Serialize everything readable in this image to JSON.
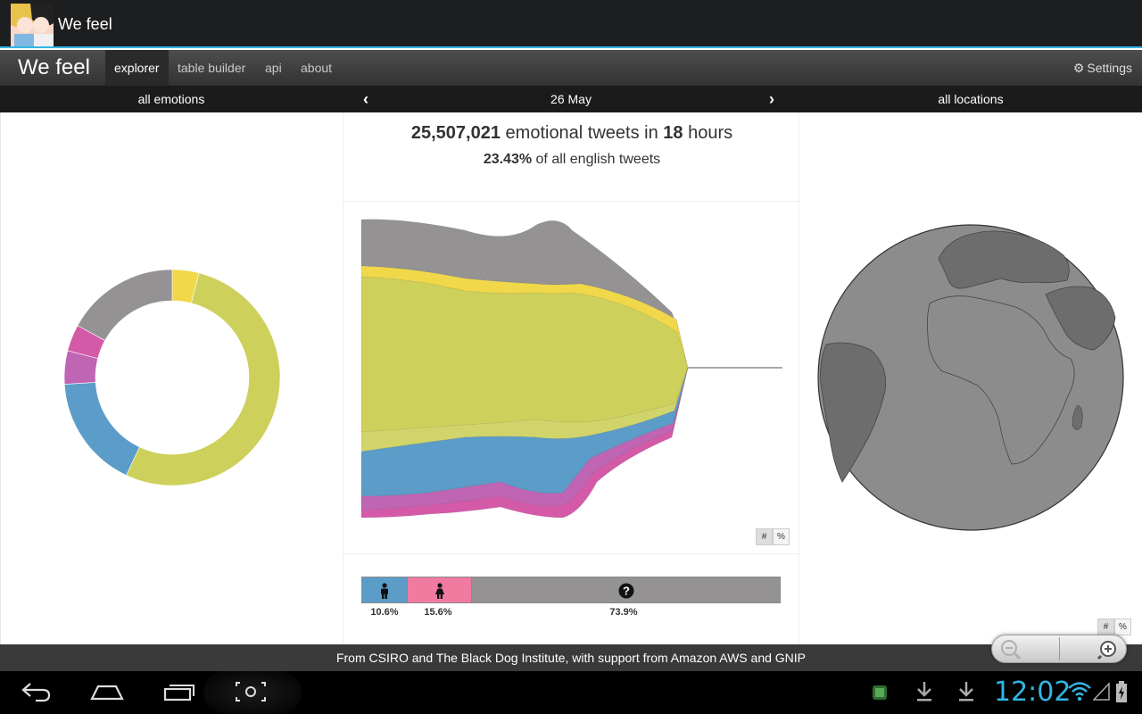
{
  "app": {
    "title": "We feel"
  },
  "navbar": {
    "brand": "We feel",
    "items": [
      {
        "label": "explorer",
        "active": true
      },
      {
        "label": "table builder",
        "active": false
      },
      {
        "label": "api",
        "active": false
      },
      {
        "label": "about",
        "active": false
      }
    ],
    "settings_label": "Settings"
  },
  "filterbar": {
    "emotions": "all emotions",
    "date": "26 May",
    "locations": "all locations"
  },
  "stats": {
    "tweet_count": "25,507,021",
    "tweets_text": "emotional tweets in",
    "hours": "18",
    "hours_text": "hours",
    "percent": "23.43%",
    "percent_text": "of all english tweets"
  },
  "toggles": {
    "count_label": "#",
    "percent_label": "%"
  },
  "gender": {
    "segments": [
      {
        "name": "male",
        "percent": 10.6,
        "label": "10.6%",
        "color": "#5b9cc8"
      },
      {
        "name": "female",
        "percent": 15.6,
        "label": "15.6%",
        "color": "#f07aa0"
      },
      {
        "name": "unknown",
        "percent": 73.9,
        "label": "73.9%",
        "color": "#949293"
      }
    ]
  },
  "emotion_colors": {
    "other": "#949293",
    "yellow": "#f0d84a",
    "olive": "#cdd05a",
    "blue": "#5b9cc8",
    "purple": "#c064b4",
    "magenta": "#d45aa8"
  },
  "donut": {
    "segments": [
      {
        "color": "#f0d84a",
        "fraction": 0.04
      },
      {
        "color": "#cdd05a",
        "fraction": 0.53
      },
      {
        "color": "#5b9cc8",
        "fraction": 0.17
      },
      {
        "color": "#c064b4",
        "fraction": 0.05
      },
      {
        "color": "#d45aa8",
        "fraction": 0.04
      },
      {
        "color": "#949293",
        "fraction": 0.17
      }
    ]
  },
  "footer": {
    "p1": "From",
    "csiro": "CSIRO",
    "p2": "and",
    "bdi": "The Black Dog Institute",
    "p3": ", with support from",
    "aws": "Amazon AWS",
    "p4": "and",
    "gnip": "GNIP"
  },
  "system": {
    "clock": "12:02",
    "accent": "#33b5e5"
  }
}
